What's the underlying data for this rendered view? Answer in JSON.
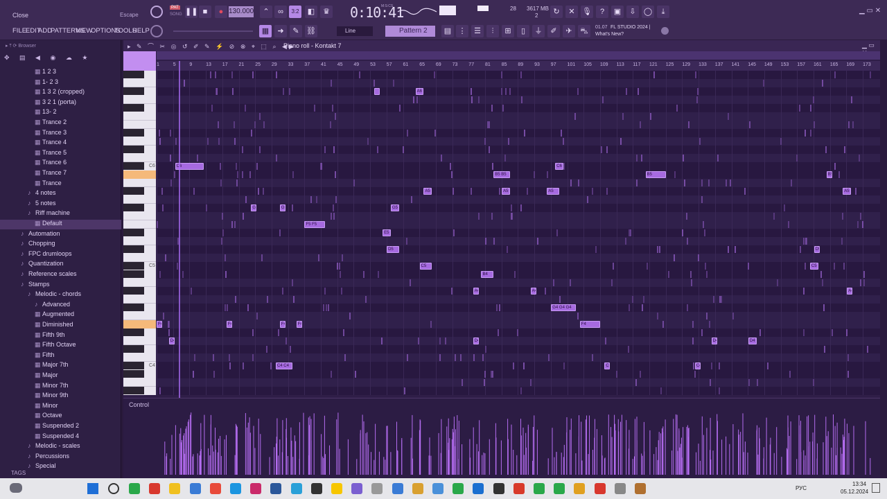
{
  "top": {
    "close_label": "Close",
    "escape_label": "Escape",
    "pat_label": "PAT",
    "song_label": "SONG",
    "tempo": "130.000",
    "time": "0:10:41",
    "time_unit": "M:S:CS",
    "cpu": "28",
    "ram": "3617 MB",
    "voices": "2",
    "news_version": "01.07",
    "news_title": "FL STUDIO 2024 |",
    "news_sub": "What's New?",
    "line_tool": "Line",
    "pattern": "Pattern 2"
  },
  "menu": [
    "FILE",
    "EDIT",
    "ADD",
    "PATTERNS",
    "VIEW",
    "OPTIONS",
    "TOOLS",
    "HELP"
  ],
  "browser": {
    "title": "Browser",
    "tags_label": "TAGS",
    "items": [
      {
        "label": "1 2 3",
        "indent": 2,
        "icon": "file-icon"
      },
      {
        "label": "1- 2 3",
        "indent": 2,
        "icon": "file-icon"
      },
      {
        "label": "1 3 2 (cropped)",
        "indent": 2,
        "icon": "file-icon"
      },
      {
        "label": "3 2 1 (porta)",
        "indent": 2,
        "icon": "file-icon"
      },
      {
        "label": "13- 2",
        "indent": 2,
        "icon": "file-icon"
      },
      {
        "label": "Trance 2",
        "indent": 2,
        "icon": "file-icon"
      },
      {
        "label": "Trance 3",
        "indent": 2,
        "icon": "file-icon"
      },
      {
        "label": "Trance 4",
        "indent": 2,
        "icon": "file-icon"
      },
      {
        "label": "Trance 5",
        "indent": 2,
        "icon": "file-icon"
      },
      {
        "label": "Trance 6",
        "indent": 2,
        "icon": "file-icon"
      },
      {
        "label": "Trance 7",
        "indent": 2,
        "icon": "file-icon"
      },
      {
        "label": "Trance",
        "indent": 2,
        "icon": "file-icon"
      },
      {
        "label": "4 notes",
        "indent": 1,
        "icon": "folder-icon"
      },
      {
        "label": "5 notes",
        "indent": 1,
        "icon": "folder-icon"
      },
      {
        "label": "Riff machine",
        "indent": 1,
        "icon": "folder-icon"
      },
      {
        "label": "Default",
        "indent": 2,
        "icon": "file-icon",
        "selected": true
      },
      {
        "label": "Automation",
        "indent": 0,
        "icon": "folder-icon"
      },
      {
        "label": "Chopping",
        "indent": 0,
        "icon": "folder-icon"
      },
      {
        "label": "FPC drumloops",
        "indent": 0,
        "icon": "folder-icon"
      },
      {
        "label": "Quantization",
        "indent": 0,
        "icon": "folder-icon"
      },
      {
        "label": "Reference scales",
        "indent": 0,
        "icon": "folder-icon"
      },
      {
        "label": "Stamps",
        "indent": 0,
        "icon": "folder-icon"
      },
      {
        "label": "Melodic - chords",
        "indent": 1,
        "icon": "folder-icon"
      },
      {
        "label": "Advanced",
        "indent": 2,
        "icon": "folder-icon"
      },
      {
        "label": "Augmented",
        "indent": 2,
        "icon": "file-icon"
      },
      {
        "label": "Diminished",
        "indent": 2,
        "icon": "file-icon"
      },
      {
        "label": "Fifth 9th",
        "indent": 2,
        "icon": "file-icon"
      },
      {
        "label": "Fifth Octave",
        "indent": 2,
        "icon": "file-icon"
      },
      {
        "label": "Fifth",
        "indent": 2,
        "icon": "file-icon"
      },
      {
        "label": "Major 7th",
        "indent": 2,
        "icon": "file-icon"
      },
      {
        "label": "Major",
        "indent": 2,
        "icon": "file-icon"
      },
      {
        "label": "Minor 7th",
        "indent": 2,
        "icon": "file-icon"
      },
      {
        "label": "Minor 9th",
        "indent": 2,
        "icon": "file-icon"
      },
      {
        "label": "Minor",
        "indent": 2,
        "icon": "file-icon"
      },
      {
        "label": "Octave",
        "indent": 2,
        "icon": "file-icon"
      },
      {
        "label": "Suspended 2",
        "indent": 2,
        "icon": "file-icon"
      },
      {
        "label": "Suspended 4",
        "indent": 2,
        "icon": "file-icon"
      },
      {
        "label": "Melodic - scales",
        "indent": 1,
        "icon": "folder-icon"
      },
      {
        "label": "Percussions",
        "indent": 1,
        "icon": "folder-icon"
      },
      {
        "label": "Special",
        "indent": 1,
        "icon": "folder-icon"
      }
    ]
  },
  "roll": {
    "title": "Piano roll - Kontakt 7",
    "control_label": "Control",
    "bars": [
      "1",
      "5",
      "9",
      "13",
      "17",
      "21",
      "25",
      "29",
      "33",
      "37",
      "41",
      "45",
      "49",
      "53",
      "57",
      "61",
      "65",
      "69",
      "73",
      "77",
      "81",
      "85",
      "89",
      "93",
      "97",
      "101",
      "105",
      "109",
      "113",
      "117",
      "121",
      "125",
      "129",
      "133",
      "137",
      "141",
      "145",
      "149",
      "153",
      "157",
      "161",
      "165",
      "169",
      "173"
    ],
    "key_labels": [
      {
        "label": "C6",
        "row": 11
      },
      {
        "label": "C5",
        "row": 23
      },
      {
        "label": "C4",
        "row": 35
      }
    ],
    "notes": [
      {
        "row": 2,
        "bar": 54,
        "len": 1,
        "label": ""
      },
      {
        "row": 2,
        "bar": 64,
        "len": 2,
        "label": "A6"
      },
      {
        "row": 11,
        "bar": 5.5,
        "len": 7,
        "label": "C6"
      },
      {
        "row": 11,
        "bar": 98,
        "len": 2,
        "label": "C6"
      },
      {
        "row": 12,
        "bar": 83,
        "len": 4,
        "label": "B5 B5"
      },
      {
        "row": 12,
        "bar": 120,
        "len": 5,
        "label": "B5"
      },
      {
        "row": 12,
        "bar": 164,
        "len": 1,
        "label": "B5"
      },
      {
        "row": 14,
        "bar": 66,
        "len": 2,
        "label": "A5"
      },
      {
        "row": 14,
        "bar": 85,
        "len": 2,
        "label": "A5"
      },
      {
        "row": 14,
        "bar": 96,
        "len": 3,
        "label": "A5"
      },
      {
        "row": 14,
        "bar": 168,
        "len": 2,
        "label": "A5"
      },
      {
        "row": 16,
        "bar": 24,
        "len": 1,
        "label": "G5"
      },
      {
        "row": 16,
        "bar": 31,
        "len": 1,
        "label": "G5"
      },
      {
        "row": 16,
        "bar": 58,
        "len": 2,
        "label": "G5"
      },
      {
        "row": 18,
        "bar": 37,
        "len": 5,
        "label": "F5 F5"
      },
      {
        "row": 19,
        "bar": 56,
        "len": 2,
        "label": "E5"
      },
      {
        "row": 21,
        "bar": 57,
        "len": 3,
        "label": "D5"
      },
      {
        "row": 21,
        "bar": 161,
        "len": 1,
        "label": "D5"
      },
      {
        "row": 23,
        "bar": 65,
        "len": 3,
        "label": "C5"
      },
      {
        "row": 23,
        "bar": 160,
        "len": 2,
        "label": "C5"
      },
      {
        "row": 24,
        "bar": 80,
        "len": 3,
        "label": "B4 B4"
      },
      {
        "row": 26,
        "bar": 78,
        "len": 1,
        "label": "A4"
      },
      {
        "row": 26,
        "bar": 92,
        "len": 1,
        "label": "A4"
      },
      {
        "row": 26,
        "bar": 169,
        "len": 1,
        "label": "A4"
      },
      {
        "row": 28,
        "bar": 97,
        "len": 6,
        "label": "G4 G4 G4"
      },
      {
        "row": 30,
        "bar": 1,
        "len": 1,
        "label": "F4"
      },
      {
        "row": 30,
        "bar": 18,
        "len": 1,
        "label": "F4"
      },
      {
        "row": 30,
        "bar": 31,
        "len": 1,
        "label": "F4"
      },
      {
        "row": 30,
        "bar": 35,
        "len": 1,
        "label": "F4"
      },
      {
        "row": 30,
        "bar": 104,
        "len": 5,
        "label": "F4"
      },
      {
        "row": 32,
        "bar": 4,
        "len": 1,
        "label": "D4"
      },
      {
        "row": 32,
        "bar": 78,
        "len": 1,
        "label": "D4"
      },
      {
        "row": 32,
        "bar": 136,
        "len": 1,
        "label": "D4"
      },
      {
        "row": 32,
        "bar": 145,
        "len": 2,
        "label": "D4"
      },
      {
        "row": 35,
        "bar": 30,
        "len": 4,
        "label": "C4 C4"
      },
      {
        "row": 35,
        "bar": 110,
        "len": 1,
        "label": "C4"
      },
      {
        "row": 35,
        "bar": 132,
        "len": 1,
        "label": "C4"
      }
    ]
  },
  "status": {
    "clock": "13:34",
    "date": "05.12.2024",
    "lang": "РУС"
  }
}
